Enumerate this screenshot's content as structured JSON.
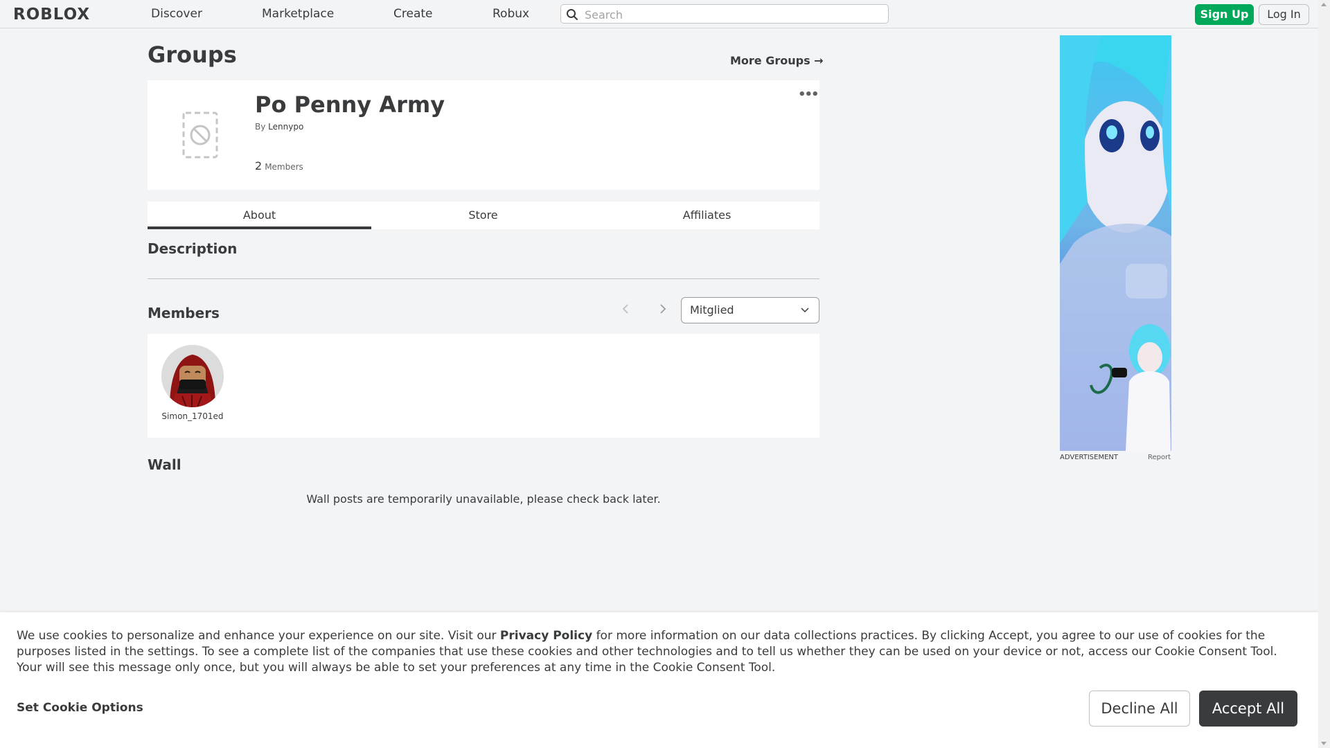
{
  "nav": {
    "logo": "ROBLOX",
    "links": [
      "Discover",
      "Marketplace",
      "Create",
      "Robux"
    ],
    "search_placeholder": "Search",
    "signup": "Sign Up",
    "login": "Log In"
  },
  "page": {
    "title": "Groups",
    "more_groups": "More Groups →"
  },
  "group": {
    "name": "Po Penny Army",
    "by_label": "By",
    "owner": "Lennypo",
    "member_count": "2",
    "members_label": "Members"
  },
  "tabs": [
    "About",
    "Store",
    "Affiliates"
  ],
  "about": {
    "description_title": "Description",
    "members_title": "Members",
    "role_selected": "Mitglied",
    "members": [
      {
        "name": "Simon_1701ed"
      }
    ],
    "wall_title": "Wall",
    "wall_message": "Wall posts are temporarily unavailable, please check back later."
  },
  "ad": {
    "label": "ADVERTISEMENT",
    "report": "Report"
  },
  "cookie": {
    "text_before": "We use cookies to personalize and enhance your experience on our site. Visit our ",
    "privacy_link": "Privacy Policy",
    "text_after": " for more information on our data collections practices. By clicking Accept, you agree to our use of cookies for the purposes listed in the settings. To see a complete list of the companies that use these cookies and other technologies and to tell us whether they can be used on your device or not, access our Cookie Consent Tool. Your will see this message only once, but you will always be able to set your preferences at any time in the Cookie Consent Tool.",
    "options": "Set Cookie Options",
    "decline": "Decline All",
    "accept": "Accept All"
  },
  "colors": {
    "background": "#f2f4f5",
    "card": "#ffffff",
    "text": "#393b3d",
    "signup_green": "#00a859",
    "accept_dark": "#393b3d"
  }
}
